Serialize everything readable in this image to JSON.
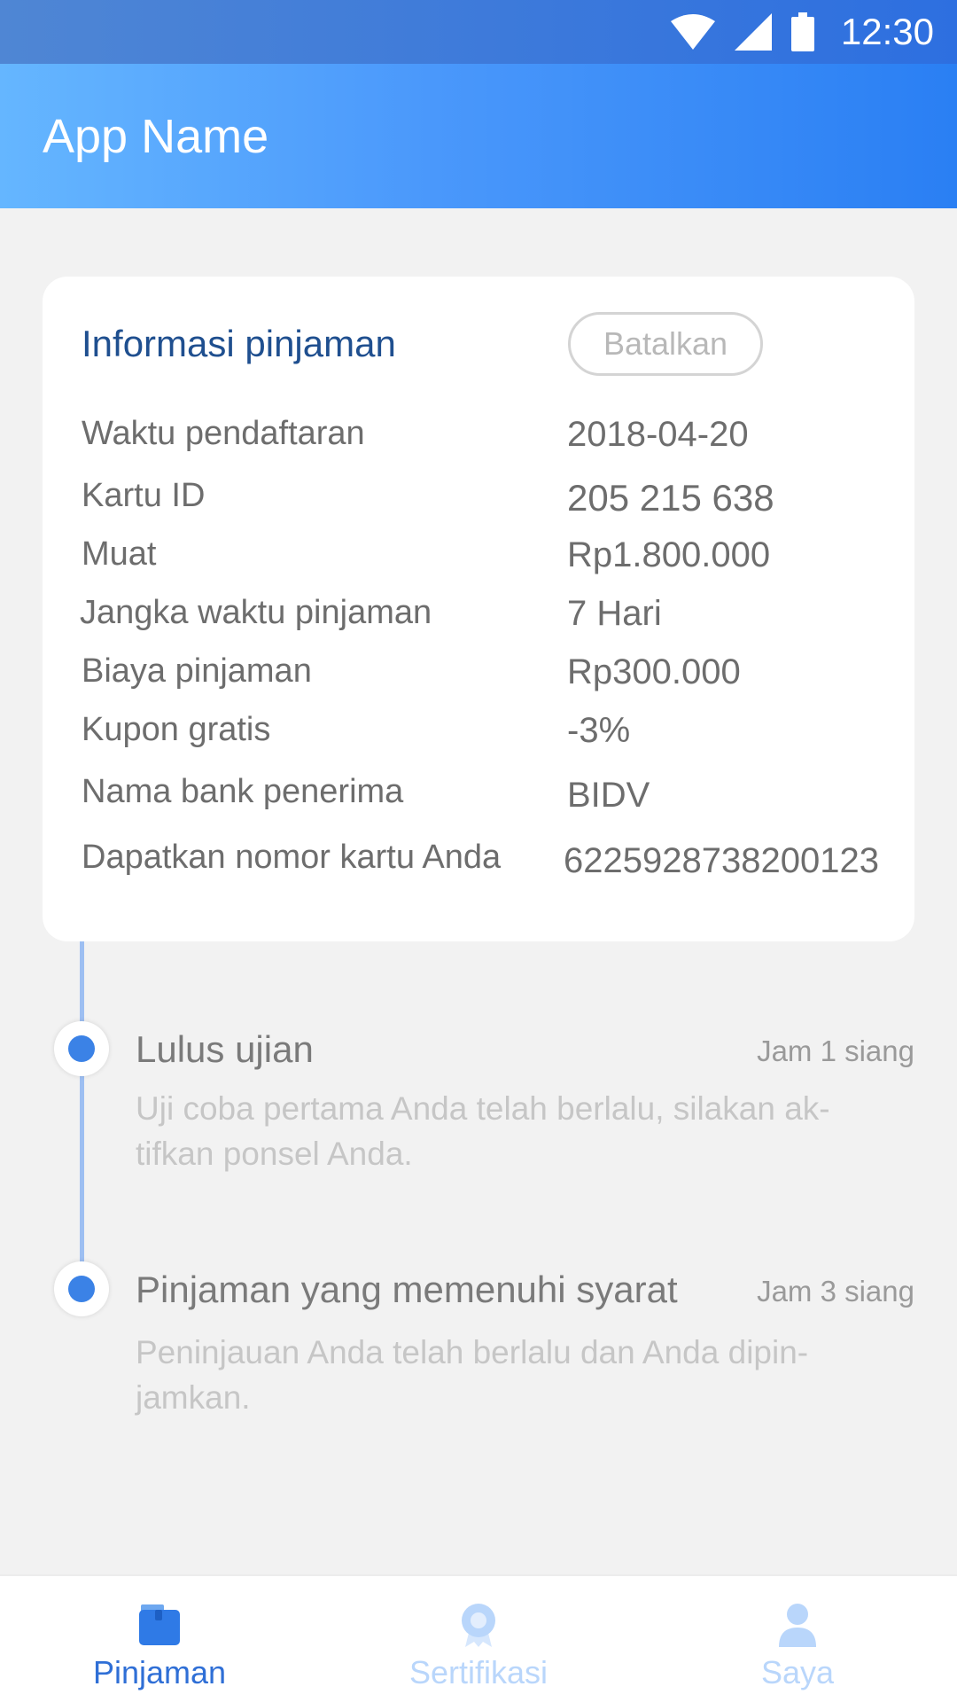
{
  "status_bar": {
    "time": "12:30"
  },
  "app_bar": {
    "title": "App Name"
  },
  "loan_card": {
    "title": "Informasi pinjaman",
    "cancel_label": "Batalkan",
    "rows": [
      {
        "label": "Waktu pendaftaran",
        "value": "2018-04-20"
      },
      {
        "label": "Kartu ID",
        "value": "205 215 638"
      },
      {
        "label": "Muat",
        "value": "Rp1.800.000"
      },
      {
        "label": "Jangka waktu pinjaman",
        "value": "7 Hari"
      },
      {
        "label": "Biaya pinjaman",
        "value": "Rp300.000"
      },
      {
        "label": "Kupon gratis",
        "value": "-3%"
      },
      {
        "label": "Nama bank penerima",
        "value": "BIDV"
      },
      {
        "label": "Dapatkan nomor kartu Anda",
        "value": "6225928738200123"
      }
    ]
  },
  "timeline": [
    {
      "title": "Lulus ujian",
      "time": "Jam 1 siang",
      "desc": "Uji coba pertama Anda telah berlalu, silakan ak-tifkan ponsel Anda."
    },
    {
      "title": "Pinjaman yang memenuhi syarat",
      "time": "Jam 3 siang",
      "desc": "Peninjauan Anda telah berlalu dan Anda dipin-jamkan."
    }
  ],
  "bottom_nav": {
    "items": [
      {
        "label": "Pinjaman",
        "icon": "wallet-icon",
        "active": true
      },
      {
        "label": "Sertifikasi",
        "icon": "badge-icon",
        "active": false
      },
      {
        "label": "Saya",
        "icon": "user-icon",
        "active": false
      }
    ]
  },
  "colors": {
    "accent": "#3b82e6",
    "nav_active": "#2f6fd6",
    "nav_inactive": "#b9d6fb",
    "card_title": "#1f4f8f"
  }
}
